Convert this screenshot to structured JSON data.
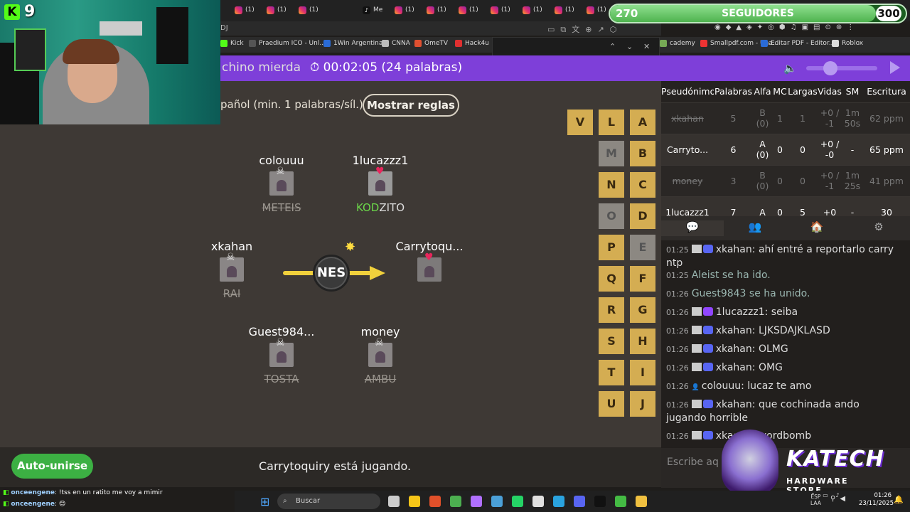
{
  "kick": {
    "viewers": "9"
  },
  "followers": {
    "current": "270",
    "label": "SEGUIDORES",
    "goal": "300",
    "progress": 0.9
  },
  "browser": {
    "tab_label": "(1)",
    "tiktok_tab_label": "Me",
    "url_fragment": "DJ",
    "bookmarks": [
      "Kick",
      "Praedium ICO - Unl...",
      "1Win Argentina",
      "CNNA",
      "OmeTV",
      "Hack4u",
      "cademy",
      "Smallpdf.com - Una...",
      "Editar PDF - Editor...",
      "Roblox"
    ]
  },
  "game": {
    "room_title": "chino mierda",
    "timer": "00:02:05 (24 palabras)",
    "language_text": "pañol (min. 1 palabras/síl.)",
    "rules_button": "Mostrar reglas",
    "syllable": "NES",
    "status_text": "Carrytoquiry está jugando.",
    "autojoin_button": "Auto-unirse",
    "players": [
      {
        "name": "colouuu",
        "word": "METEIS",
        "struck": true,
        "avatar": "skull"
      },
      {
        "name": "1lucazzz1",
        "word_hl": "KOD",
        "word_rest": "ZITO",
        "struck": false,
        "avatar": "heart"
      },
      {
        "name": "xkahan",
        "word": "RAI",
        "struck": true,
        "avatar": "skull"
      },
      {
        "name": "Carrytoqu...",
        "word": "",
        "struck": false,
        "avatar": "heart"
      },
      {
        "name": "Guest984...",
        "word": "TOSTA",
        "struck": true,
        "avatar": "skull"
      },
      {
        "name": "money",
        "word": "AMBU",
        "struck": true,
        "avatar": "skull"
      }
    ],
    "letters": [
      {
        "l": "V",
        "used": false
      },
      {
        "l": "L",
        "used": false
      },
      {
        "l": "A",
        "used": false
      },
      {
        "l": "M",
        "used": true
      },
      {
        "l": "B",
        "used": false
      },
      {
        "l": "N",
        "used": false
      },
      {
        "l": "C",
        "used": false
      },
      {
        "l": "O",
        "used": true
      },
      {
        "l": "D",
        "used": false
      },
      {
        "l": "P",
        "used": false
      },
      {
        "l": "E",
        "used": true
      },
      {
        "l": "Q",
        "used": false
      },
      {
        "l": "F",
        "used": false
      },
      {
        "l": "R",
        "used": false
      },
      {
        "l": "G",
        "used": false
      },
      {
        "l": "S",
        "used": false
      },
      {
        "l": "H",
        "used": false
      },
      {
        "l": "T",
        "used": false
      },
      {
        "l": "I",
        "used": false
      },
      {
        "l": "U",
        "used": false
      },
      {
        "l": "J",
        "used": false
      }
    ]
  },
  "scoreboard": {
    "headers": [
      "Pseudónimo",
      "Palabras",
      "Alfa",
      "MC",
      "Largas",
      "Vidas",
      "SM",
      "Escritura"
    ],
    "rows": [
      {
        "alive": false,
        "cells": [
          "xkahan",
          "5",
          "B (0)",
          "1",
          "1",
          "+0 / -1",
          "1m 50s",
          "62 ppm"
        ]
      },
      {
        "alive": true,
        "cells": [
          "Carryto...",
          "6",
          "A (0)",
          "0",
          "0",
          "+0 / -0",
          "-",
          "65 ppm"
        ]
      },
      {
        "alive": false,
        "cells": [
          "money",
          "3",
          "B (0)",
          "0",
          "0",
          "+0 / -1",
          "1m 25s",
          "41 ppm"
        ]
      },
      {
        "alive": true,
        "cells": [
          "1lucazzz1",
          "7",
          "A",
          "0",
          "5",
          "+0",
          "-",
          "30"
        ]
      }
    ]
  },
  "chat": {
    "tabs": [
      "chat-icon",
      "players-icon",
      "room-icon",
      "settings-icon"
    ],
    "messages": [
      {
        "time": "01:25",
        "icon": "discord",
        "user": "xkahan",
        "text": "ahí entré a reportarlo carry ntp"
      },
      {
        "time": "01:25",
        "sys": true,
        "text": "Aleist se ha ido."
      },
      {
        "time": "01:26",
        "sys": true,
        "text": "Guest9843 se ha unido."
      },
      {
        "time": "01:26",
        "icon": "twitch",
        "user": "1lucazzz1",
        "text": "seiba"
      },
      {
        "time": "01:26",
        "icon": "discord",
        "user": "xkahan",
        "text": "LJKSDAJKLASD"
      },
      {
        "time": "01:26",
        "icon": "discord",
        "user": "xkahan",
        "text": "OLMG"
      },
      {
        "time": "01:26",
        "icon": "discord",
        "user": "xkahan",
        "text": "OMG"
      },
      {
        "time": "01:26",
        "icon": "guest",
        "user": "colouuu",
        "text": "lucaz te amo"
      },
      {
        "time": "01:26",
        "icon": "discord",
        "user": "xkahan",
        "text": "que cochinada ando jugando horrible"
      },
      {
        "time": "01:26",
        "icon": "discord",
        "user": "xka",
        "text": "e a wordbomb"
      }
    ],
    "input_placeholder": "Escribe aq"
  },
  "sponsor": {
    "brand": "KATECH",
    "sub": "HARDWARE STORE"
  },
  "kick_chat": [
    {
      "user": "onceengene",
      "text": "!tss en un ratito me voy a mimir"
    },
    {
      "user": "onceengene",
      "text": "😊"
    }
  ],
  "taskbar": {
    "search": "Buscar",
    "lang": "ESP",
    "lang2": "LAA",
    "time": "01:26",
    "date": "23/11/2025"
  },
  "colors": {
    "accent": "#7e3fd9",
    "tile": "#d4ad52",
    "kick": "#53fc18",
    "follow": "#4fb34f"
  }
}
